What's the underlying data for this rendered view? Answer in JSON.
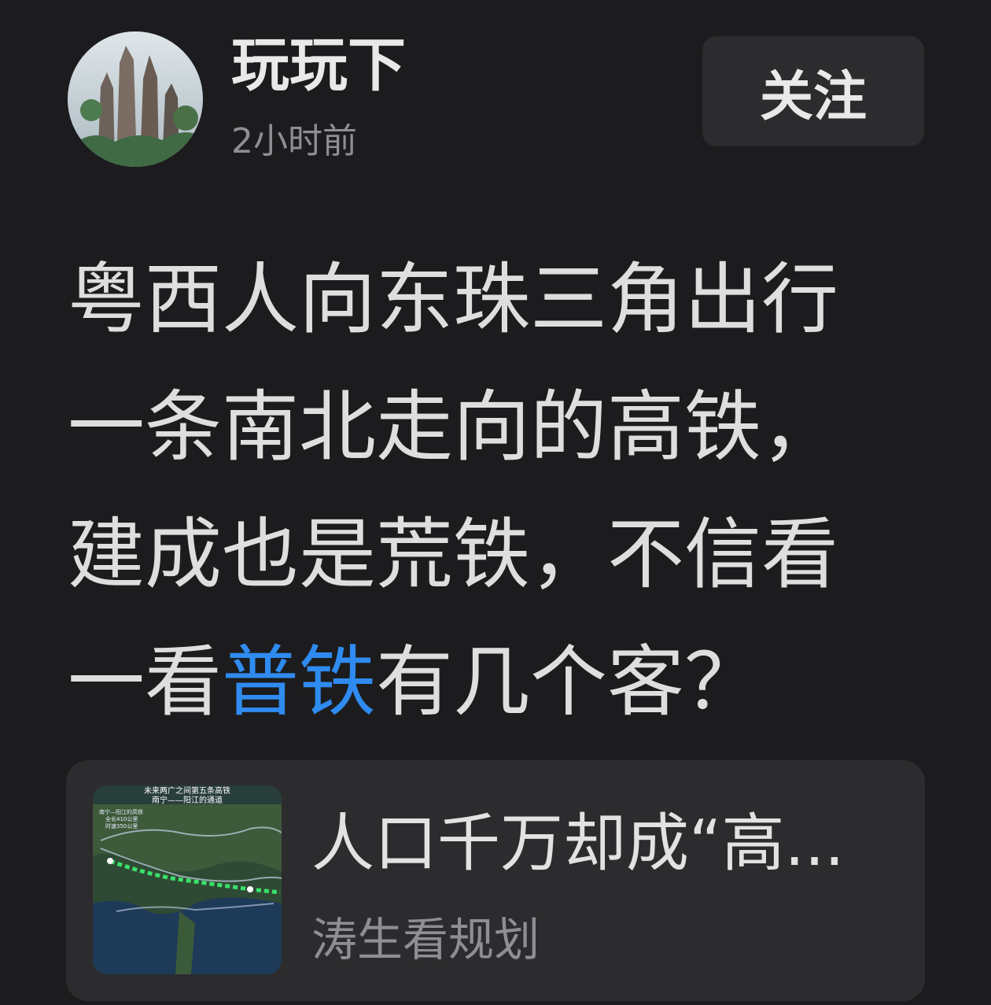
{
  "author": {
    "name": "玩玩下",
    "time": "2小时前",
    "avatar_icon": "mountain-landscape-avatar"
  },
  "follow": {
    "label": "关注"
  },
  "post": {
    "line1": "粤西人向东珠三角出行",
    "line2": "一条南北走向的高铁，",
    "line3": "建成也是荒铁，不信看",
    "line4_pre": "一看",
    "line4_link": "普铁",
    "line4_post": "有几个客？",
    "link_color": "#2f8bf0"
  },
  "linked_article": {
    "title": "人口千万却成“高...",
    "author": "涛生看规划",
    "thumbnail": {
      "title_line1": "未来两广之间第五条高铁",
      "title_line2": "南宁——阳江的通道",
      "info_line1": "南宁—阳江的高铁",
      "info_line2": "全长410公里",
      "info_line3": "时速350公里"
    }
  }
}
